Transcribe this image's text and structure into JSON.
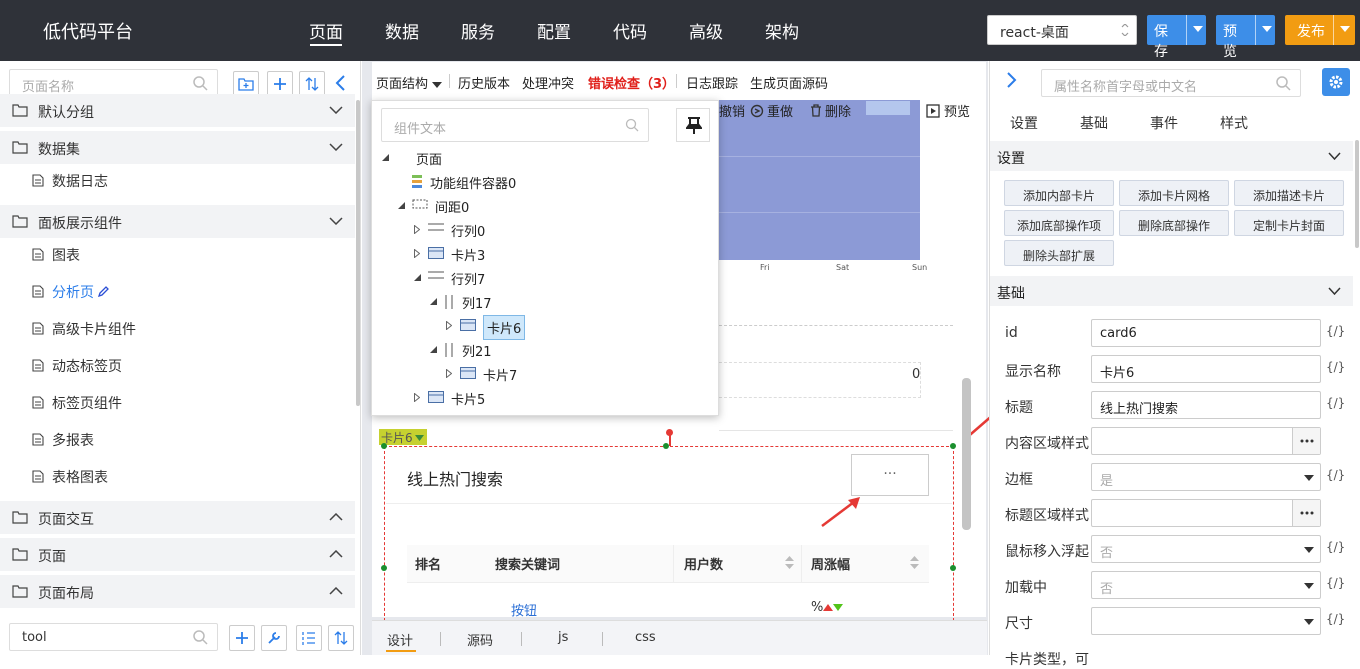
{
  "header": {
    "app_title": "低代码平台",
    "nav": [
      "页面",
      "数据",
      "服务",
      "配置",
      "代码",
      "高级",
      "架构"
    ],
    "env_select": "react-桌面",
    "save_label": "保存",
    "preview_label": "预览",
    "publish_label": "发布",
    "colors": {
      "bar": "#2f3239",
      "save": "#3d8ee8",
      "preview": "#3d8ee8",
      "publish": "#f29c12"
    }
  },
  "left_panel": {
    "search_placeholder": "页面名称",
    "groups": [
      {
        "label": "默认分组",
        "expanded": true
      },
      {
        "label": "数据集",
        "expanded": true,
        "items": [
          "数据日志"
        ]
      },
      {
        "label": "面板展示组件",
        "expanded": true,
        "items": [
          "图表",
          "分析页",
          "高级卡片组件",
          "动态标签页",
          "标签页组件",
          "多报表",
          "表格图表"
        ]
      },
      {
        "label": "页面交互",
        "expanded": false
      },
      {
        "label": "页面",
        "expanded": false
      },
      {
        "label": "页面布局",
        "expanded": false
      }
    ],
    "active_item": "分析页",
    "bottom_search_value": "tool"
  },
  "center": {
    "toolbar": {
      "page_structure": "页面结构",
      "history": "历史版本",
      "conflict": "处理冲突",
      "error_check": "错误检查（3）",
      "log_trace": "日志跟踪",
      "gen_source": "生成页面源码",
      "undo": "撤销",
      "redo": "重做",
      "delete": "删除",
      "preview": "预览"
    },
    "chart_days": [
      "Fri",
      "Sat",
      "Sun"
    ],
    "stat_value": "0",
    "card_tag": "卡片6",
    "card": {
      "title": "线上热门搜索",
      "more": "···",
      "columns": [
        "排名",
        "搜索关键词",
        "用户数",
        "周涨幅"
      ],
      "row_keyword": "按钮",
      "row_change": "%"
    },
    "bottom_tabs": [
      "设计",
      "源码",
      "js",
      "css"
    ]
  },
  "tree_popup": {
    "search_placeholder": "组件文本",
    "nodes": [
      {
        "label": "页面",
        "depth": 0,
        "icon": "none",
        "expander": "open"
      },
      {
        "label": "功能组件容器0",
        "depth": 1,
        "icon": "container",
        "expander": "none"
      },
      {
        "label": "间距0",
        "depth": 1,
        "icon": "spacer",
        "expander": "open"
      },
      {
        "label": "行列0",
        "depth": 2,
        "icon": "row",
        "expander": "closed"
      },
      {
        "label": "卡片3",
        "depth": 2,
        "icon": "card",
        "expander": "closed"
      },
      {
        "label": "行列7",
        "depth": 2,
        "icon": "row",
        "expander": "open"
      },
      {
        "label": "列17",
        "depth": 3,
        "icon": "col",
        "expander": "open"
      },
      {
        "label": "卡片6",
        "depth": 4,
        "icon": "card",
        "expander": "closed",
        "selected": true
      },
      {
        "label": "列21",
        "depth": 3,
        "icon": "col",
        "expander": "open"
      },
      {
        "label": "卡片7",
        "depth": 4,
        "icon": "card",
        "expander": "closed"
      },
      {
        "label": "卡片5",
        "depth": 2,
        "icon": "card",
        "expander": "closed"
      }
    ]
  },
  "right_panel": {
    "search_placeholder": "属性名称首字母或中文名",
    "tabs": [
      "设置",
      "基础",
      "事件",
      "样式"
    ],
    "settings_header": "设置",
    "actions": [
      "添加内部卡片",
      "添加卡片网格",
      "添加描述卡片",
      "添加底部操作项",
      "删除底部操作",
      "定制卡片封面",
      "删除头部扩展"
    ],
    "basic_header": "基础",
    "props": [
      {
        "label": "id",
        "value": "card6",
        "type": "text"
      },
      {
        "label": "显示名称",
        "value": "卡片6",
        "type": "text"
      },
      {
        "label": "标题",
        "value": "线上热门搜索",
        "type": "text"
      },
      {
        "label": "内容区域样式",
        "value": "",
        "type": "dots"
      },
      {
        "label": "边框",
        "value": "是",
        "type": "select"
      },
      {
        "label": "标题区域样式",
        "value": "",
        "type": "dots"
      },
      {
        "label": "鼠标移入浮起",
        "value": "否",
        "type": "select"
      },
      {
        "label": "加载中",
        "value": "否",
        "type": "select"
      },
      {
        "label": "尺寸",
        "value": "",
        "type": "select"
      },
      {
        "label": "卡片类型，可",
        "value": "",
        "type": "none"
      }
    ],
    "expr_label": "{/}"
  }
}
